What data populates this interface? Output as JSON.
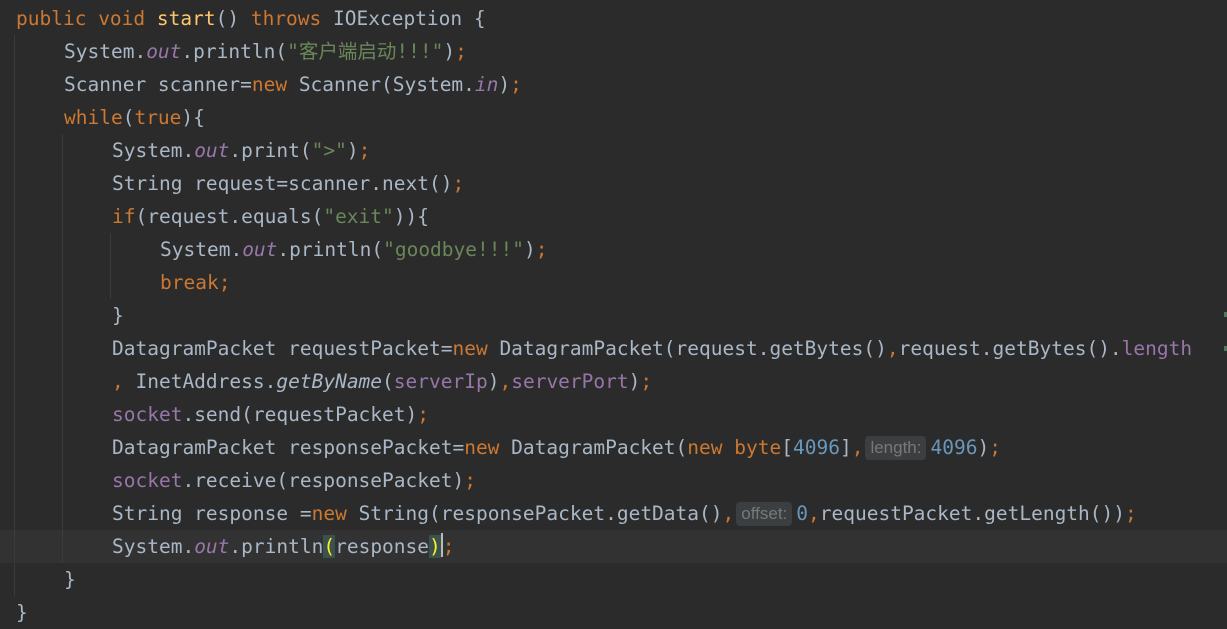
{
  "editor": {
    "lines": [
      {
        "indent": 0,
        "current": false,
        "tokens": [
          {
            "t": "public ",
            "c": "keyword"
          },
          {
            "t": "void ",
            "c": "keyword"
          },
          {
            "t": "start",
            "c": "method"
          },
          {
            "t": "() ",
            "c": "plain"
          },
          {
            "t": "throws ",
            "c": "keyword"
          },
          {
            "t": "IOException {",
            "c": "plain"
          }
        ]
      },
      {
        "indent": 1,
        "current": false,
        "tokens": [
          {
            "t": "System.",
            "c": "plain"
          },
          {
            "t": "out",
            "c": "static"
          },
          {
            "t": ".println(",
            "c": "plain"
          },
          {
            "t": "\"",
            "c": "string"
          },
          {
            "t": "客户端启动",
            "c": "string cjk"
          },
          {
            "t": "!!!\"",
            "c": "string"
          },
          {
            "t": ")",
            "c": "plain"
          },
          {
            "t": ";",
            "c": "punct"
          }
        ]
      },
      {
        "indent": 1,
        "current": false,
        "tokens": [
          {
            "t": "Scanner scanner=",
            "c": "plain"
          },
          {
            "t": "new ",
            "c": "keyword"
          },
          {
            "t": "Scanner(System.",
            "c": "plain"
          },
          {
            "t": "in",
            "c": "static"
          },
          {
            "t": ")",
            "c": "plain"
          },
          {
            "t": ";",
            "c": "punct"
          }
        ]
      },
      {
        "indent": 1,
        "current": false,
        "tokens": [
          {
            "t": "while",
            "c": "keyword"
          },
          {
            "t": "(",
            "c": "plain"
          },
          {
            "t": "true",
            "c": "keyword"
          },
          {
            "t": "){",
            "c": "plain"
          }
        ]
      },
      {
        "indent": 2,
        "current": false,
        "tokens": [
          {
            "t": "System.",
            "c": "plain"
          },
          {
            "t": "out",
            "c": "static"
          },
          {
            "t": ".print(",
            "c": "plain"
          },
          {
            "t": "\">\"",
            "c": "string"
          },
          {
            "t": ")",
            "c": "plain"
          },
          {
            "t": ";",
            "c": "punct"
          }
        ]
      },
      {
        "indent": 2,
        "current": false,
        "tokens": [
          {
            "t": "String request=scanner.next()",
            "c": "plain"
          },
          {
            "t": ";",
            "c": "punct"
          }
        ]
      },
      {
        "indent": 2,
        "current": false,
        "tokens": [
          {
            "t": "if",
            "c": "keyword"
          },
          {
            "t": "(request.equals(",
            "c": "plain"
          },
          {
            "t": "\"exit\"",
            "c": "string"
          },
          {
            "t": ")){",
            "c": "plain"
          }
        ]
      },
      {
        "indent": 3,
        "current": false,
        "tokens": [
          {
            "t": "System.",
            "c": "plain"
          },
          {
            "t": "out",
            "c": "static"
          },
          {
            "t": ".println(",
            "c": "plain"
          },
          {
            "t": "\"goodbye!!!\"",
            "c": "string"
          },
          {
            "t": ")",
            "c": "plain"
          },
          {
            "t": ";",
            "c": "punct"
          }
        ]
      },
      {
        "indent": 3,
        "current": false,
        "tokens": [
          {
            "t": "break",
            "c": "keyword"
          },
          {
            "t": ";",
            "c": "punct"
          }
        ]
      },
      {
        "indent": 2,
        "current": false,
        "tokens": [
          {
            "t": "}",
            "c": "plain"
          }
        ]
      },
      {
        "indent": 2,
        "current": false,
        "tokens": [
          {
            "t": "DatagramPacket requestPacket=",
            "c": "plain"
          },
          {
            "t": "new ",
            "c": "keyword"
          },
          {
            "t": "DatagramPacket(request.getBytes()",
            "c": "plain"
          },
          {
            "t": ",",
            "c": "punct"
          },
          {
            "t": "request.getBytes().",
            "c": "plain"
          },
          {
            "t": "length",
            "c": "field"
          }
        ]
      },
      {
        "indent": 2,
        "current": false,
        "tokens": [
          {
            "t": ", ",
            "c": "punct"
          },
          {
            "t": "InetAddress.",
            "c": "plain"
          },
          {
            "t": "getByName",
            "c": "italic-plain"
          },
          {
            "t": "(",
            "c": "plain"
          },
          {
            "t": "serverIp",
            "c": "field"
          },
          {
            "t": ")",
            "c": "plain"
          },
          {
            "t": ",",
            "c": "punct"
          },
          {
            "t": "serverPort",
            "c": "field"
          },
          {
            "t": ")",
            "c": "plain"
          },
          {
            "t": ";",
            "c": "punct"
          }
        ]
      },
      {
        "indent": 2,
        "current": false,
        "tokens": [
          {
            "t": "socket",
            "c": "field"
          },
          {
            "t": ".send(requestPacket)",
            "c": "plain"
          },
          {
            "t": ";",
            "c": "punct"
          }
        ]
      },
      {
        "indent": 2,
        "current": false,
        "tokens": [
          {
            "t": "DatagramPacket responsePacket=",
            "c": "plain"
          },
          {
            "t": "new ",
            "c": "keyword"
          },
          {
            "t": "DatagramPacket(",
            "c": "plain"
          },
          {
            "t": "new ",
            "c": "keyword"
          },
          {
            "t": "byte",
            "c": "keyword"
          },
          {
            "t": "[",
            "c": "plain"
          },
          {
            "t": "4096",
            "c": "number"
          },
          {
            "t": "]",
            "c": "plain"
          },
          {
            "t": ",",
            "c": "punct"
          },
          {
            "t": "length:",
            "c": "hint"
          },
          {
            "t": "4096",
            "c": "number"
          },
          {
            "t": ")",
            "c": "plain"
          },
          {
            "t": ";",
            "c": "punct"
          }
        ]
      },
      {
        "indent": 2,
        "current": false,
        "tokens": [
          {
            "t": "socket",
            "c": "field"
          },
          {
            "t": ".receive(responsePacket)",
            "c": "plain"
          },
          {
            "t": ";",
            "c": "punct"
          }
        ]
      },
      {
        "indent": 2,
        "current": false,
        "tokens": [
          {
            "t": "String response =",
            "c": "plain"
          },
          {
            "t": "new ",
            "c": "keyword"
          },
          {
            "t": "String(responsePacket.getData()",
            "c": "plain"
          },
          {
            "t": ",",
            "c": "punct"
          },
          {
            "t": "offset:",
            "c": "hint"
          },
          {
            "t": "0",
            "c": "number"
          },
          {
            "t": ",",
            "c": "punct"
          },
          {
            "t": "requestPacket.getLength())",
            "c": "plain"
          },
          {
            "t": ";",
            "c": "punct"
          }
        ]
      },
      {
        "indent": 2,
        "current": true,
        "tokens": [
          {
            "t": "System.",
            "c": "plain"
          },
          {
            "t": "out",
            "c": "static"
          },
          {
            "t": ".println",
            "c": "plain"
          },
          {
            "t": "(",
            "c": "brace"
          },
          {
            "t": "response",
            "c": "plain"
          },
          {
            "t": ")",
            "c": "brace"
          },
          {
            "t": "",
            "c": "caret"
          },
          {
            "t": ";",
            "c": "punct"
          }
        ]
      },
      {
        "indent": 1,
        "current": false,
        "tokens": [
          {
            "t": "}",
            "c": "plain"
          }
        ]
      },
      {
        "indent": 0,
        "current": false,
        "tokens": [
          {
            "t": "}",
            "c": "plain"
          }
        ]
      }
    ]
  }
}
